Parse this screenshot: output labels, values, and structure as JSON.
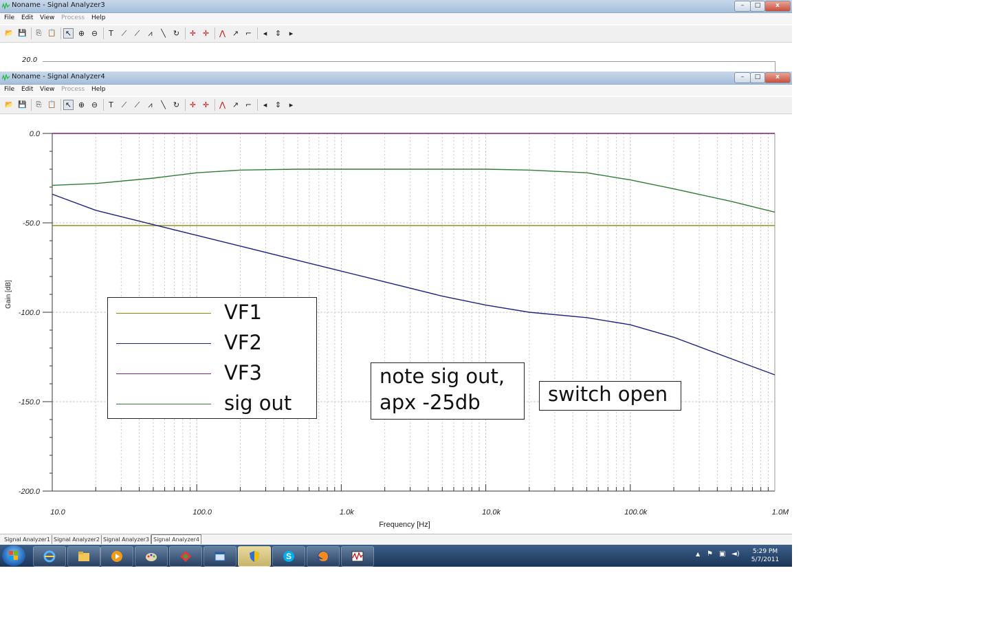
{
  "window_back": {
    "title": "Noname - Signal Analyzer3",
    "menu": [
      "File",
      "Edit",
      "View",
      "Process",
      "Help"
    ],
    "axis_peek_label": "20.0"
  },
  "window_front": {
    "title": "Noname - Signal Analyzer4",
    "menu": [
      "File",
      "Edit",
      "View",
      "Process",
      "Help"
    ]
  },
  "window_controls": {
    "minimize": "–",
    "maximize": "□",
    "close": "x"
  },
  "chart_data": {
    "type": "line",
    "xlabel": "Frequency [Hz]",
    "ylabel": "Gain [dB]",
    "xscale": "log",
    "xlim": [
      10,
      1000000
    ],
    "ylim": [
      -200,
      0
    ],
    "xticks": [
      {
        "value": 10,
        "label": "10.0"
      },
      {
        "value": 100,
        "label": "100.0"
      },
      {
        "value": 1000,
        "label": "1.0k"
      },
      {
        "value": 10000,
        "label": "10.0k"
      },
      {
        "value": 100000,
        "label": "100.0k"
      },
      {
        "value": 1000000,
        "label": "1.0M"
      }
    ],
    "yticks": [
      {
        "value": 0,
        "label": "0.0"
      },
      {
        "value": -50,
        "label": "-50.0"
      },
      {
        "value": -100,
        "label": "-100.0"
      },
      {
        "value": -150,
        "label": "-150.0"
      },
      {
        "value": -200,
        "label": "-200.0"
      }
    ],
    "grid": true,
    "legend_placement": "lower-left",
    "series": [
      {
        "name": "VF1",
        "color": "#8b8b00",
        "points": [
          [
            10,
            -51.5
          ],
          [
            1000000,
            -51.5
          ]
        ]
      },
      {
        "name": "VF2",
        "color": "#1a237e",
        "points": [
          [
            10,
            -34
          ],
          [
            20,
            -43
          ],
          [
            50,
            -51
          ],
          [
            100,
            -57
          ],
          [
            200,
            -63
          ],
          [
            500,
            -71
          ],
          [
            1000,
            -77
          ],
          [
            2000,
            -83
          ],
          [
            5000,
            -91
          ],
          [
            10000,
            -96
          ],
          [
            20000,
            -100
          ],
          [
            50000,
            -103
          ],
          [
            100000,
            -107
          ],
          [
            200000,
            -114
          ],
          [
            500000,
            -126
          ],
          [
            1000000,
            -135
          ]
        ]
      },
      {
        "name": "VF3",
        "color": "#7b1f7b",
        "points": [
          [
            10,
            0
          ],
          [
            1000000,
            0
          ]
        ]
      },
      {
        "name": "sig out",
        "color": "#2e7d32",
        "points": [
          [
            10,
            -29
          ],
          [
            20,
            -28
          ],
          [
            50,
            -25
          ],
          [
            100,
            -22
          ],
          [
            200,
            -20.5
          ],
          [
            500,
            -20
          ],
          [
            2000,
            -20
          ],
          [
            10000,
            -20
          ],
          [
            20000,
            -20.5
          ],
          [
            50000,
            -22
          ],
          [
            100000,
            -26
          ],
          [
            200000,
            -31
          ],
          [
            500000,
            -38
          ],
          [
            1000000,
            -44
          ]
        ]
      }
    ],
    "annotations": [
      {
        "lines": [
          "note sig out,",
          "apx -25db"
        ]
      },
      {
        "lines": [
          "switch open"
        ]
      }
    ]
  },
  "tabs": [
    "Signal Analyzer1",
    "Signal Analyzer2",
    "Signal Analyzer3",
    "Signal Analyzer4"
  ],
  "taskbar": {
    "apps": [
      "start-button",
      "internet-explorer-icon",
      "folder-icon",
      "media-player-icon",
      "paint-icon",
      "app-icon",
      "window-icon",
      "shield-icon",
      "skype-icon",
      "firefox-icon",
      "tina-icon"
    ],
    "clock_time": "5:29 PM",
    "clock_date": "5/7/2011"
  }
}
